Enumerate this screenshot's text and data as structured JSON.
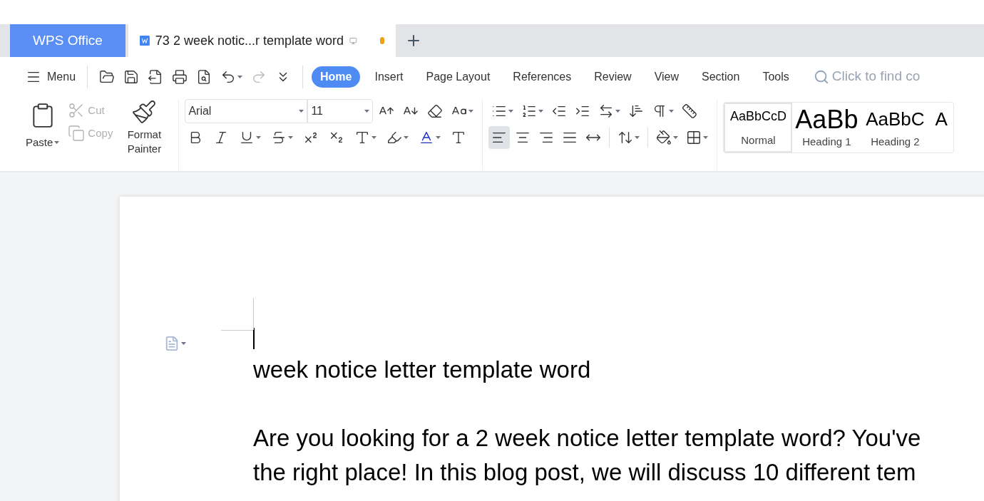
{
  "tabs": [
    {
      "label": "WPS Office",
      "kind": "home",
      "selected": false
    },
    {
      "label": "73 2 week notic...r template word",
      "kind": "document",
      "selected": true,
      "unsaved": true
    }
  ],
  "menu_button": "Menu",
  "ribbon_tabs": [
    {
      "label": "Home",
      "selected": true
    },
    {
      "label": "Insert",
      "selected": false
    },
    {
      "label": "Page Layout",
      "selected": false
    },
    {
      "label": "References",
      "selected": false
    },
    {
      "label": "Review",
      "selected": false
    },
    {
      "label": "View",
      "selected": false
    },
    {
      "label": "Section",
      "selected": false
    },
    {
      "label": "Tools",
      "selected": false
    }
  ],
  "search": {
    "placeholder": "Click to find co"
  },
  "clipboard": {
    "paste": "Paste",
    "cut": {
      "label": "Cut",
      "disabled": true
    },
    "copy": {
      "label": "Copy",
      "disabled": true
    },
    "format_painter": "Format Painter"
  },
  "font": {
    "family": "Arial",
    "size": "11"
  },
  "alignment": [
    {
      "kind": "left",
      "selected": true
    },
    {
      "kind": "center",
      "selected": false
    },
    {
      "kind": "right",
      "selected": false
    },
    {
      "kind": "justify",
      "selected": false
    },
    {
      "kind": "distributed",
      "selected": false
    }
  ],
  "styles": [
    {
      "preview": "AaBbCcD",
      "label": "Normal",
      "kind": "normal",
      "selected": true
    },
    {
      "preview": "AaBb",
      "label": "Heading 1",
      "kind": "h1",
      "selected": false
    },
    {
      "preview": "AaBbC",
      "label": "Heading 2",
      "kind": "h2",
      "selected": false
    },
    {
      "preview": "A",
      "kind": "h3",
      "selected": false
    }
  ],
  "document": {
    "heading": "week notice letter template word",
    "paragraph_lines": [
      "Are you looking for a 2 week notice letter template word? You've",
      "the right place! In this blog post, we will discuss 10 different tem"
    ]
  }
}
